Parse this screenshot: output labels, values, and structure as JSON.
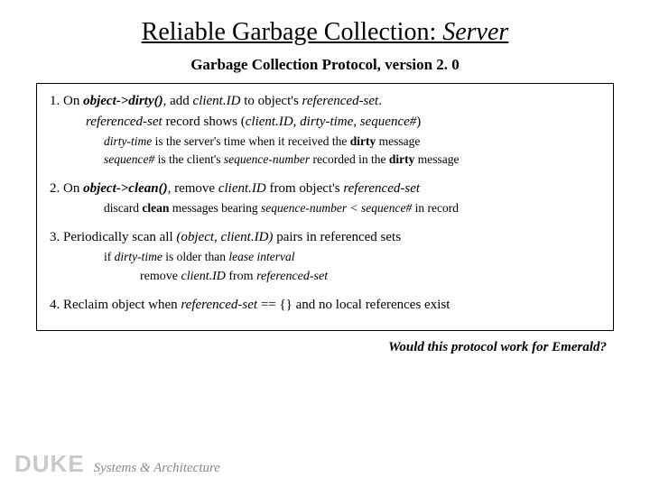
{
  "title": {
    "prefix": "Reliable Garbage Collection: ",
    "em": "Server"
  },
  "subtitle": "Garbage Collection Protocol, version 2. 0",
  "section1": {
    "lead_num": "1. On ",
    "call": "object->dirty()",
    "mid1": ", add ",
    "clientid": "client.ID",
    "mid2": " to object's ",
    "refset": "referenced-set",
    "dot": ".",
    "line2_a": "referenced-set",
    "line2_b": " record shows (",
    "line2_c": "client.ID, dirty-time, sequence#",
    "line2_d": ")",
    "note1_a": "dirty-time",
    "note1_b": " is the server's time when it received the ",
    "note1_c": "dirty",
    "note1_d": " message",
    "note2_a": "sequence#",
    "note2_b": " is the client's ",
    "note2_c": "sequence-number",
    "note2_d": " recorded in the ",
    "note2_e": "dirty",
    "note2_f": " message"
  },
  "section2": {
    "lead_num": "2. On ",
    "call": "object->clean()",
    "mid1": ", remove ",
    "clientid": "client.ID",
    "mid2": " from object's ",
    "refset": "referenced-set",
    "note_a": "discard ",
    "note_b": "clean",
    "note_c": " messages bearing ",
    "note_d": "sequence-number < sequence#",
    "note_e": " in record"
  },
  "section3": {
    "lead": "3. Periodically scan all ",
    "tuple": "(object, client.ID)",
    "tail": " pairs in referenced sets",
    "note1_a": "if ",
    "note1_b": "dirty-time",
    "note1_c": " is older than ",
    "note1_d": "lease interval",
    "note2_a": "remove ",
    "note2_b": "client.ID",
    "note2_c": " from ",
    "note2_d": "referenced-set"
  },
  "section4": {
    "lead": "4. Reclaim object when ",
    "cond": "referenced-set",
    "eq": " == {} and no local references exist"
  },
  "question": "Would this protocol work for Emerald?",
  "footer": {
    "duke": "DUKE",
    "sys": "Systems",
    "amp": "&",
    "arch": "Architecture"
  }
}
